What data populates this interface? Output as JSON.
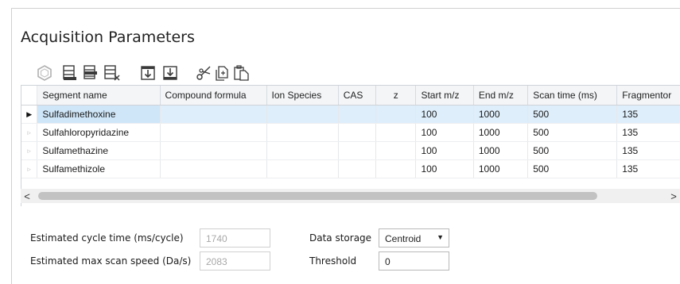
{
  "title": "Acquisition Parameters",
  "toolbar": {
    "icons": [
      "hexagon-icon",
      "add-row-icon",
      "insert-row-icon",
      "delete-row-icon",
      "move-down-icon",
      "move-last-icon",
      "cut-icon",
      "copy-icon",
      "paste-icon"
    ]
  },
  "table": {
    "columns": [
      "Segment name",
      "Compound formula",
      "Ion Species",
      "CAS",
      "z",
      "Start m/z",
      "End m/z",
      "Scan time (ms)",
      "Fragmentor"
    ],
    "rows": [
      {
        "indicator": "▶",
        "cells": [
          "Sulfadimethoxine",
          "",
          "",
          "",
          "",
          "100",
          "1000",
          "500",
          "135"
        ]
      },
      {
        "indicator": "▹",
        "cells": [
          "Sulfahloropyridazine",
          "",
          "",
          "",
          "",
          "100",
          "1000",
          "500",
          "135"
        ]
      },
      {
        "indicator": "▹",
        "cells": [
          "Sulfamethazine",
          "",
          "",
          "",
          "",
          "100",
          "1000",
          "500",
          "135"
        ]
      },
      {
        "indicator": "▹",
        "cells": [
          "Sulfamethizole",
          "",
          "",
          "",
          "",
          "100",
          "1000",
          "500",
          "135"
        ]
      }
    ]
  },
  "scrollbar": {
    "left": "<",
    "right": ">"
  },
  "fields": {
    "cycle_time": {
      "label": "Estimated cycle time (ms/cycle)",
      "value": "1740"
    },
    "scan_speed": {
      "label": "Estimated max scan speed (Da/s)",
      "value": "2083"
    },
    "data_storage": {
      "label": "Data storage",
      "value": "Centroid",
      "arrow": "▼"
    },
    "threshold": {
      "label": "Threshold",
      "value": "0"
    }
  },
  "colors": {
    "selection": "#deeefb",
    "icon": "#3a3a3a"
  }
}
